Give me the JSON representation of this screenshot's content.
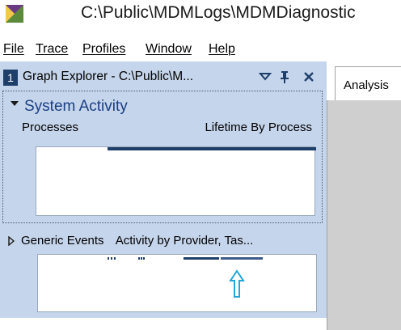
{
  "window": {
    "title": "C:\\Public\\MDMLogs\\MDMDiagnostic"
  },
  "menu": [
    {
      "label": "File"
    },
    {
      "label": "Trace"
    },
    {
      "label": "Profiles"
    },
    {
      "label": "Window"
    },
    {
      "label": "Help"
    }
  ],
  "graph_explorer": {
    "number": "1",
    "title": "Graph Explorer - C:\\Public\\M...",
    "icons": [
      "dropdown-icon",
      "pin-icon",
      "close-icon"
    ],
    "system_activity": {
      "title": "System Activity",
      "left_label": "Processes",
      "right_label": "Lifetime By Process"
    },
    "generic_events": {
      "title": "Generic Events",
      "subtitle": "Activity by Provider, Tas..."
    }
  },
  "analysis": {
    "tab_label": "Analysis"
  },
  "colors": {
    "panel_bg": "#c5d5eb",
    "accent_dark": "#1f3f6b",
    "title_blue": "#1b3f83",
    "arrow": "#22a5d8"
  }
}
